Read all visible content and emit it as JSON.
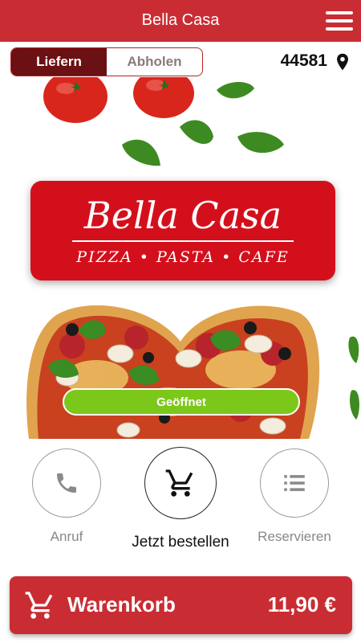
{
  "header": {
    "title": "Bella Casa",
    "menu_icon": "hamburger-menu-icon"
  },
  "mode_switch": {
    "options": [
      "Liefern",
      "Abholen"
    ],
    "selected": "Liefern"
  },
  "location": {
    "postal_code": "44581",
    "icon": "location-pin-icon"
  },
  "logo": {
    "name": "Bella Casa",
    "tagline": "PIZZA • PASTA • CAFE"
  },
  "status": {
    "label": "Geöffnet",
    "color": "#7cc81a"
  },
  "actions": [
    {
      "label": "Anruf",
      "icon": "phone-icon"
    },
    {
      "label": "Jetzt bestellen",
      "icon": "cart-icon"
    },
    {
      "label": "Reservieren",
      "icon": "list-icon"
    }
  ],
  "cart": {
    "label": "Warenkorb",
    "total": "11,90 €",
    "icon": "cart-icon"
  },
  "colors": {
    "brand_red": "#c92d33",
    "active_segment": "#6b1013",
    "open_green": "#7cc81a"
  }
}
